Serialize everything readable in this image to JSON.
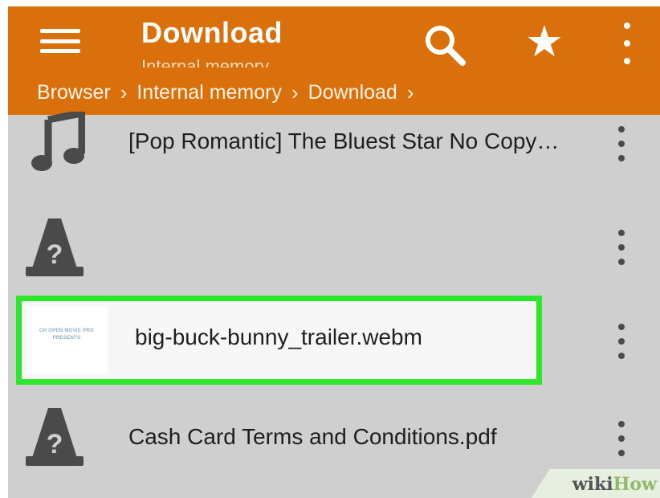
{
  "toolbar": {
    "title": "Download",
    "subtitle": "Internal memory",
    "star_glyph": "★",
    "color": "#d9700b"
  },
  "breadcrumb": [
    "Browser",
    "Internal memory",
    "Download"
  ],
  "breadcrumb_separator": "›",
  "files": [
    {
      "name": "[Pop Romantic] The Bluest Star  No Copy…",
      "icon": "music-note-icon"
    },
    {
      "name": "",
      "icon": "unknown-file-cone-icon"
    },
    {
      "name": "big-buck-bunny_trailer.webm",
      "icon": "video-thumbnail",
      "highlighted": true,
      "thumbnail_text": [
        "CH OPEN MOVIE PRO",
        "PRESENTS"
      ]
    },
    {
      "name": "Cash Card Terms and Conditions.pdf",
      "icon": "unknown-file-cone-icon"
    }
  ],
  "highlight_color": "#2ee62e",
  "watermark": {
    "part1": "wiki",
    "part2": "How"
  }
}
